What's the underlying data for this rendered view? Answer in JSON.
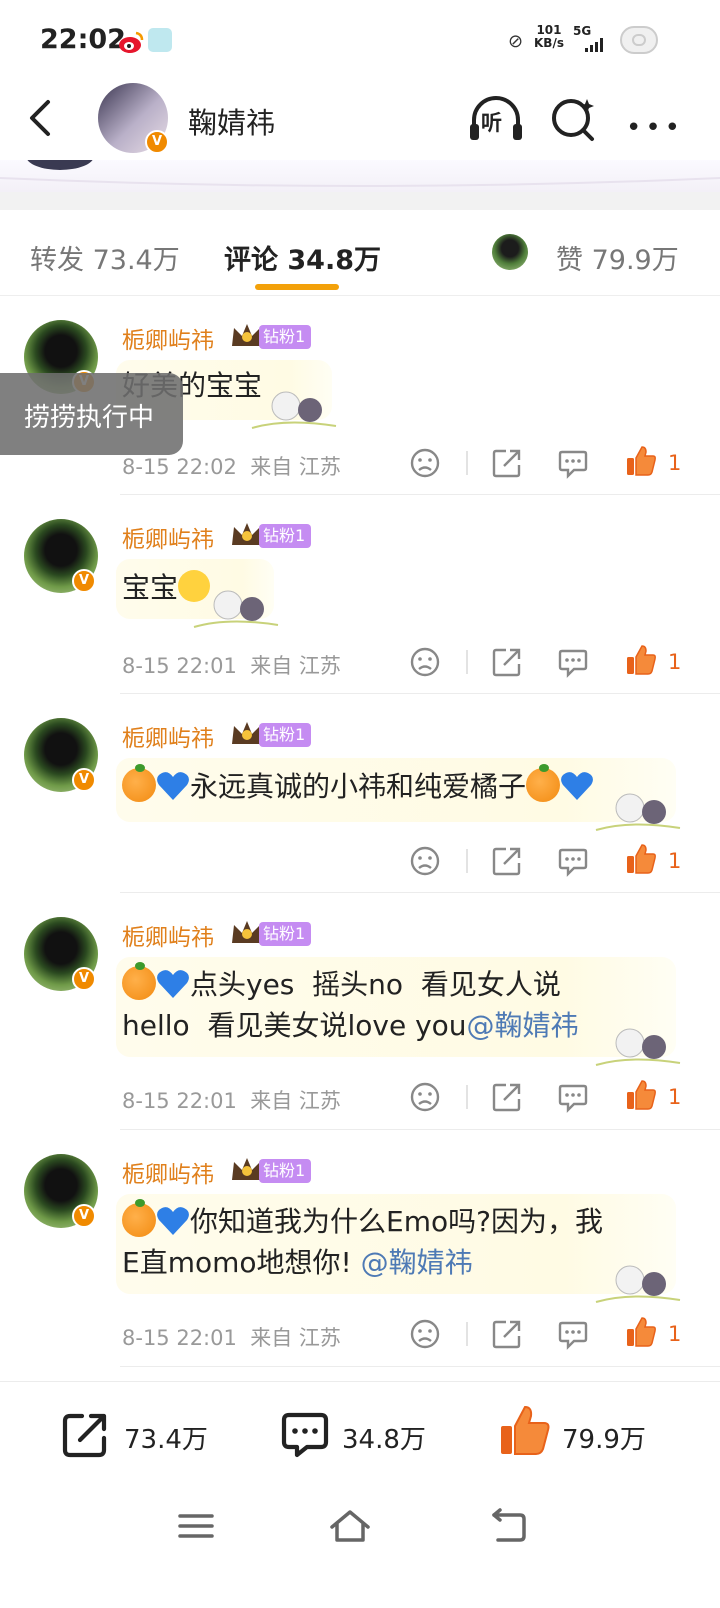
{
  "status_bar": {
    "time": "22:02",
    "net_speed_value": "101",
    "net_speed_unit": "KB/s",
    "network_type": "5G"
  },
  "header": {
    "user_name": "鞠婧祎",
    "listen_label": "听",
    "more_label": "•••"
  },
  "tabs": {
    "repost": "转发 73.4万",
    "comment": "评论 34.8万",
    "like": "赞 79.9万"
  },
  "toast": {
    "text": "捞捞执行中"
  },
  "comments": [
    {
      "name": "栀卿屿祎",
      "fan_badge": "钻粉1",
      "text": "好美的宝宝",
      "time": "8-15 22:02",
      "source": "来自 江苏",
      "likes": "1"
    },
    {
      "name": "栀卿屿祎",
      "fan_badge": "钻粉1",
      "text": "宝宝",
      "time": "8-15 22:01",
      "source": "来自 江苏",
      "likes": "1"
    },
    {
      "name": "栀卿屿祎",
      "fan_badge": "钻粉1",
      "text": "永远真诚的小祎和纯爱橘子",
      "likes": "1"
    },
    {
      "name": "栀卿屿祎",
      "fan_badge": "钻粉1",
      "text_line1": "点头yes  摇头no  看见女人说",
      "text_line2": "hello  看见美女说love you",
      "mention": "@鞠婧祎",
      "time": "8-15 22:01",
      "source": "来自 江苏",
      "likes": "1"
    },
    {
      "name": "栀卿屿祎",
      "fan_badge": "钻粉1",
      "text_line1": "你知道我为什么Emo吗?因为，我",
      "text_line2": "E直momo地想你! ",
      "mention": "@鞠婧祎",
      "time": "8-15 22:01",
      "source": "来自 江苏",
      "likes": "1"
    }
  ],
  "bottom_bar": {
    "repost_count": "73.4万",
    "comment_count": "34.8万",
    "like_count": "79.9万"
  },
  "colors": {
    "accent_orange": "#f3a10a",
    "name_orange": "#e0801c",
    "like_red": "#e8621a",
    "mention_blue": "#4e7ab5",
    "fan_badge_purple": "#c58cf2"
  }
}
